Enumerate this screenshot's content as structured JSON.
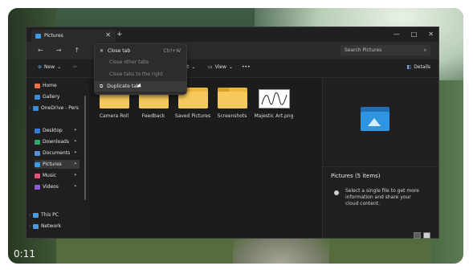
{
  "video": {
    "timestamp": "0:11"
  },
  "window": {
    "tab_title": "Pictures",
    "new_tab_symbol": "+",
    "search_placeholder": "Search Pictures",
    "controls": [
      "—",
      "□",
      "✕"
    ]
  },
  "toolbar": {
    "new_label": "New",
    "sort_label": "Sort",
    "view_label": "View",
    "more_label": "•••",
    "details_label": "Details"
  },
  "sidebar": {
    "items": [
      {
        "label": "Home",
        "icon": "home-icon",
        "color": "#e8734a"
      },
      {
        "label": "Gallery",
        "icon": "gallery-icon",
        "color": "#3c8ad8"
      },
      {
        "label": "OneDrive - Pers",
        "icon": "onedrive-icon",
        "color": "#3c8ad8"
      },
      {
        "label": "Desktop",
        "icon": "desktop-icon",
        "color": "#3a7bd5"
      },
      {
        "label": "Downloads",
        "icon": "downloads-icon",
        "color": "#2eaa6a"
      },
      {
        "label": "Documents",
        "icon": "documents-icon",
        "color": "#5a8fd8"
      },
      {
        "label": "Pictures",
        "icon": "pictures-icon",
        "color": "#3c9be8"
      },
      {
        "label": "Music",
        "icon": "music-icon",
        "color": "#e0567a"
      },
      {
        "label": "Videos",
        "icon": "videos-icon",
        "color": "#8b5cd6"
      },
      {
        "label": "This PC",
        "icon": "pc-icon",
        "color": "#4a9ae0"
      },
      {
        "label": "Network",
        "icon": "network-icon",
        "color": "#4a9ae0"
      }
    ]
  },
  "content": {
    "items": [
      {
        "label": "Camera Roll",
        "kind": "folder"
      },
      {
        "label": "Feedback",
        "kind": "folder"
      },
      {
        "label": "Saved Pictures",
        "kind": "folder"
      },
      {
        "label": "Screenshots",
        "kind": "folder"
      },
      {
        "label": "Majestic Art.png",
        "kind": "image"
      }
    ]
  },
  "context_menu": {
    "items": [
      {
        "label": "Close tab",
        "shortcut": "Ctrl+W",
        "enabled": true
      },
      {
        "label": "Close other tabs",
        "shortcut": "",
        "enabled": false
      },
      {
        "label": "Close tabs to the right",
        "shortcut": "",
        "enabled": false
      },
      {
        "label": "Duplicate tab",
        "shortcut": "",
        "enabled": true
      }
    ]
  },
  "details": {
    "title": "Pictures (5 items)",
    "message": "Select a single file to get more information and share your cloud content."
  }
}
